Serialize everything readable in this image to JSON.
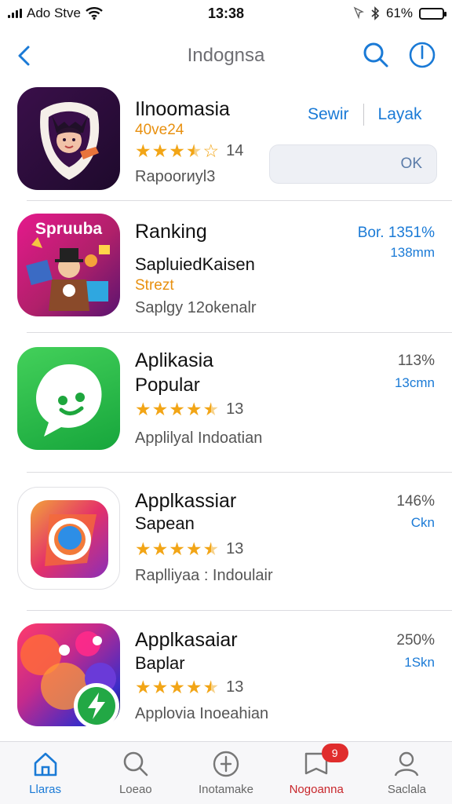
{
  "status_bar": {
    "carrier": "Ado Stve",
    "time": "13:38",
    "battery": "61%",
    "battery_level": 0.61
  },
  "nav": {
    "title": "Indognsa"
  },
  "apps": [
    {
      "name": "Ilnoomasia",
      "orange_text": "40ve24",
      "rating": 3.5,
      "rating_count": "14",
      "description": "Rapoorиyl3",
      "action_left": "Sewir",
      "action_right": "Layak",
      "ok_label": "OK",
      "icon": "masked-woman-icon"
    },
    {
      "name": "Ranking",
      "icon_text": "Spruuba",
      "subtitle": "SapluiedKaisen",
      "orange_text": "Strezt",
      "description": "Saplgy 12okenalr",
      "stat_top": "Bor. 1351%",
      "stat_bottom": "138mm",
      "icon": "cartoon-characters-icon"
    },
    {
      "name": "Aplikasia",
      "subtitle": "Popular",
      "rating": 4.5,
      "rating_count": "13",
      "description": "Applilyal Indoatian",
      "stat_top": "113%",
      "stat_bottom": "13cmn",
      "icon": "chat-bubble-leaf-icon"
    },
    {
      "name": "Applkassiar",
      "subtitle": "Sapean",
      "rating": 4.5,
      "rating_count": "13",
      "description": "Raplliyaa : Indoulair",
      "stat_top": "146%",
      "stat_bottom": "Ckn",
      "icon": "gradient-camera-icon"
    },
    {
      "name": "Applkasaiar",
      "subtitle": "Baplar",
      "rating": 4.5,
      "rating_count": "13",
      "description": "Applovia Inoeahian",
      "stat_top": "250%",
      "stat_bottom": "1Skn",
      "icon": "colorful-blob-lightning-icon"
    }
  ],
  "tabs": [
    {
      "label": "Llaras",
      "icon": "home-icon",
      "active": true
    },
    {
      "label": "Loeao",
      "icon": "search-icon"
    },
    {
      "label": "Inotamake",
      "icon": "compass-plus-icon"
    },
    {
      "label": "Nogoanna",
      "icon": "bookmark-icon",
      "badge": "9"
    },
    {
      "label": "Saclala",
      "icon": "person-icon"
    }
  ],
  "colors": {
    "accent_blue": "#1a7ad6",
    "star_orange": "#f2a516",
    "badge_red": "#e02d2d"
  }
}
